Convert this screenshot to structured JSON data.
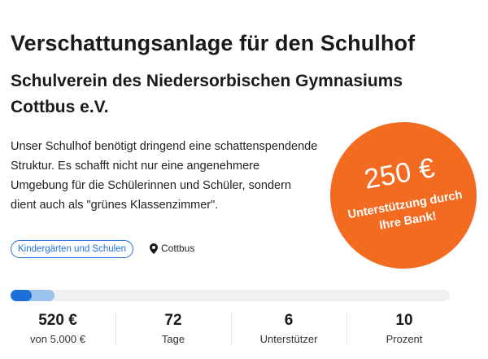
{
  "project": {
    "title": "Verschattungsanlage für den Schulhof",
    "organization": "Schulverein des Niedersorbischen Gymnasiums Cottbus e.V.",
    "description": "Unser Schulhof benötigt dringend eine schattenspendende Struktur. Es schafft nicht nur eine angenehmere Umgebung für die Schülerinnen und Schüler, sondern dient auch als \"grünes Klassenzimmer\"."
  },
  "badge": {
    "amount": "250 €",
    "text": "Unterstützung durch Ihre Bank!",
    "color": "#f36b21"
  },
  "category": {
    "label": "Kindergärten und Schulen",
    "color": "#1e6fd9"
  },
  "location": {
    "icon": "map-pin-icon",
    "label": "Cottbus"
  },
  "progress": {
    "percent": 10,
    "color": "#1e6fd9",
    "secondary_color": "#9cc3ee"
  },
  "stats": [
    {
      "value": "520 €",
      "label": "von 5.000 €"
    },
    {
      "value": "72",
      "label": "Tage"
    },
    {
      "value": "6",
      "label": "Unterstützer"
    },
    {
      "value": "10",
      "label": "Prozent"
    }
  ]
}
